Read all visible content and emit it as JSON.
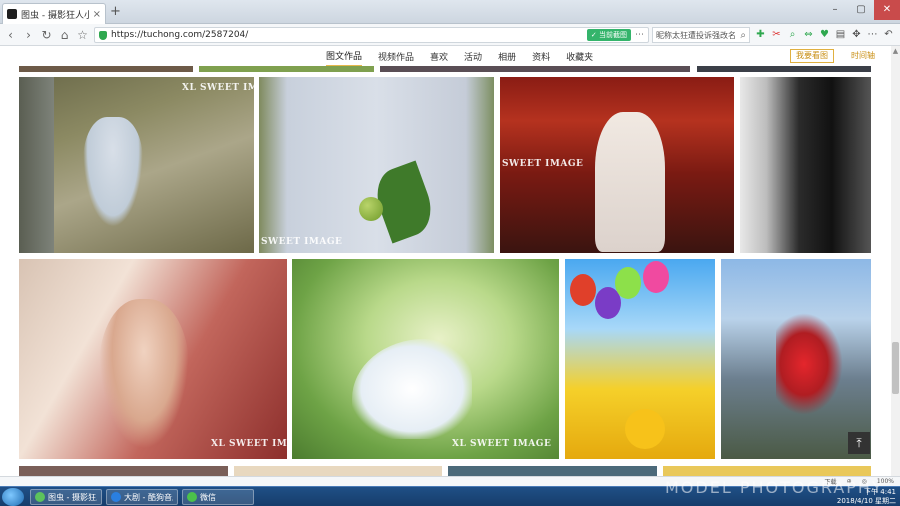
{
  "tab": {
    "title": "图虫 - 摄影狂人小童童 - 图虫网",
    "close": "×",
    "new_tab": "+"
  },
  "window_controls": {
    "min": "–",
    "max": "▢",
    "close": "✕"
  },
  "address": {
    "back": "‹",
    "forward": "›",
    "reload": "↻",
    "home": "⌂",
    "star": "☆",
    "url": "https://tuchong.com/2587204/",
    "screenshot_chip": "✓ 当前截图",
    "extra_icon": "⋯"
  },
  "search": {
    "text": "昵称太狂遭投诉强改名",
    "icon": "⌕"
  },
  "tools": [
    "✚",
    "✂",
    "⌕",
    "⇔",
    "♥",
    "▤",
    "✥",
    "⋯",
    "↶",
    "⋮"
  ],
  "subnav": {
    "items": [
      "图文作品",
      "视频作品",
      "喜欢",
      "活动",
      "相册",
      "资料",
      "收藏夹"
    ],
    "active_index": 0,
    "highlight_button": "我要看图",
    "timeline_link": "时间轴"
  },
  "watermarks": {
    "xl_sweet": "XL SWEET IMAGE",
    "sweet": "SWEET IMAGE"
  },
  "back_to_top": "⤒",
  "status": [
    "下载",
    "⊕",
    "◎",
    "100%"
  ],
  "taskbar": {
    "tasks": [
      "图虫 - 摄影狂人...",
      "大剧 - 酷狗音乐 ...",
      "微信"
    ],
    "time": "下午 4:41",
    "date": "2018/4/10 星期二"
  },
  "overlay_watermark": "MODEL PHOTOGRAPHY"
}
